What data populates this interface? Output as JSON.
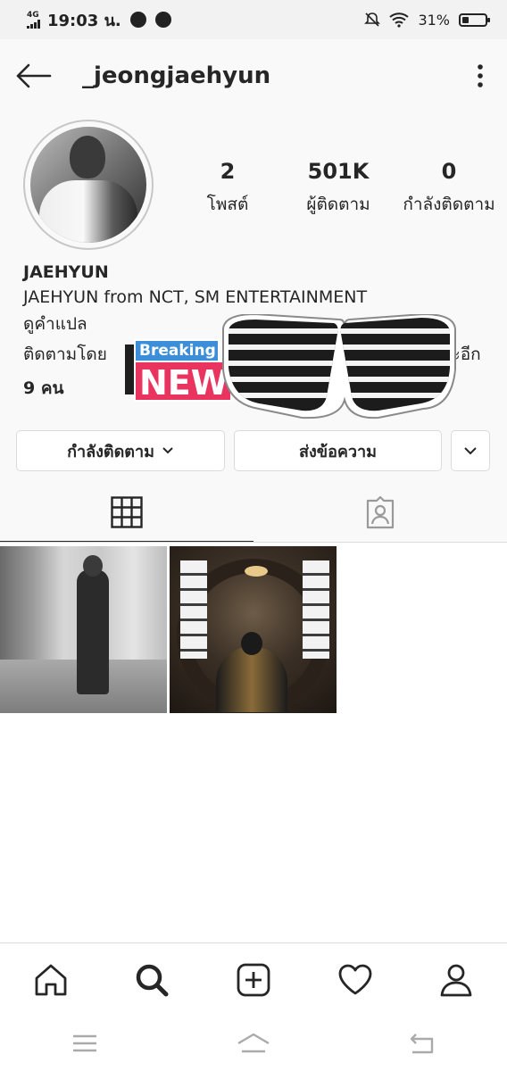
{
  "status_bar": {
    "network": "4G",
    "time": "19:03 น.",
    "battery": "31%",
    "battery_level": 0.31,
    "icons": [
      "signal-icon",
      "messenger-icon",
      "app-icon",
      "mute-icon",
      "wifi-icon",
      "battery-icon"
    ]
  },
  "header": {
    "username": "_jeongjaehyun",
    "icons": [
      "back-arrow-icon",
      "more-options-icon"
    ]
  },
  "profile": {
    "stats": [
      {
        "value": "2",
        "label": "โพสต์"
      },
      {
        "value": "501K",
        "label": "ผู้ติดตาม"
      },
      {
        "value": "0",
        "label": "กำลังติดตาม"
      }
    ],
    "name": "JAEHYUN",
    "bio": "JAEHYUN from NCT, SM ENTERTAINMENT",
    "translate": "ดูคำแปล",
    "followed_by_prefix": "ติดตามโดย",
    "followed_by_suffix": "ละอีก",
    "followed_by_count": "9 คน"
  },
  "stickers": {
    "breaking": "Breaking",
    "news": "NEWS"
  },
  "buttons": {
    "following": "กำลังติดตาม",
    "message": "ส่งข้อความ"
  },
  "tabs": [
    {
      "name": "grid",
      "icon": "grid-icon",
      "active": true
    },
    {
      "name": "tagged",
      "icon": "tagged-icon",
      "active": false
    }
  ],
  "bottom_nav": [
    "home-icon",
    "search-icon",
    "add-post-icon",
    "activity-heart-icon",
    "profile-icon"
  ],
  "system_nav": [
    "menu-icon",
    "home-button-icon",
    "back-button-icon"
  ],
  "colors": {
    "text": "#262626",
    "border": "#dbdbdb",
    "news_pink": "#e9345f",
    "news_blue": "#3d8ed9"
  }
}
